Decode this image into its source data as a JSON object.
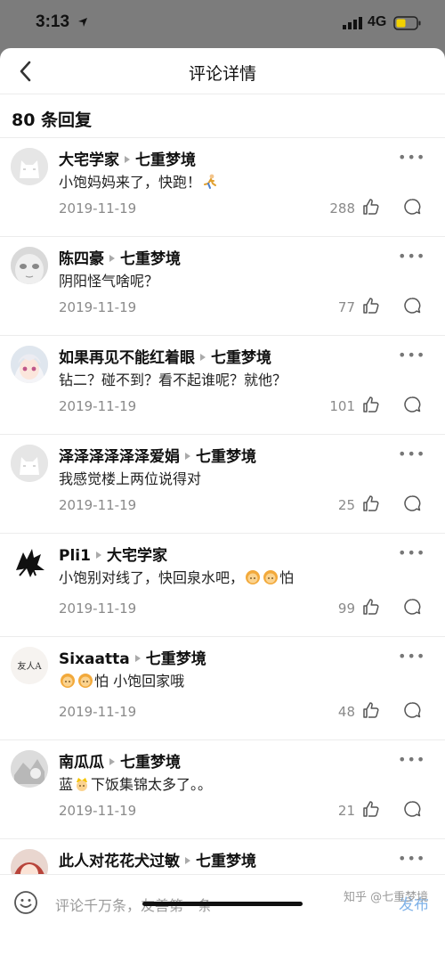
{
  "status_bar": {
    "time": "3:13",
    "network": "4G"
  },
  "header": {
    "title": "评论详情"
  },
  "reply_count": "80 条回复",
  "comments": [
    {
      "user": "大宅学家",
      "reply_to": "七重梦境",
      "text": "小饱妈妈来了，快跑！",
      "emoji_after": "runner",
      "date": "2019-11-19",
      "likes": "288",
      "avatar": "cat-avatar"
    },
    {
      "user": "陈四豪",
      "reply_to": "七重梦境",
      "text": "阴阳怪气啥呢？",
      "date": "2019-11-19",
      "likes": "77",
      "avatar": "face-avatar"
    },
    {
      "user": "如果再见不能红着眼",
      "reply_to": "七重梦境",
      "text": "钻二？碰不到？看不起谁呢？就他？",
      "date": "2019-11-19",
      "likes": "101",
      "avatar": "anime-girl-avatar"
    },
    {
      "user": "泽泽泽泽泽泽爱娟",
      "reply_to": "七重梦境",
      "text": "我感觉楼上两位说得对",
      "date": "2019-11-19",
      "likes": "25",
      "avatar": "cat-avatar"
    },
    {
      "user": "Pli1",
      "reply_to": "大宅学家",
      "text_before": "小饱别对线了，快回泉水吧，",
      "text_after": "怕",
      "date": "2019-11-19",
      "likes": "99",
      "avatar": "ink-avatar"
    },
    {
      "user": "Sixaatta",
      "reply_to": "七重梦境",
      "text_after": "怕 小饱回家哦",
      "date": "2019-11-19",
      "likes": "48",
      "avatar": "calligraphy-avatar",
      "avatar_text": "友人A"
    },
    {
      "user": "南瓜瓜",
      "reply_to": "七重梦境",
      "text_before": "蓝",
      "text_after": "下饭集锦太多了。。",
      "date": "2019-11-19",
      "likes": "21",
      "avatar": "sketch-avatar"
    },
    {
      "user": "此人对花花犬过敏",
      "reply_to": "七重梦境",
      "avatar": "red-hair-avatar"
    }
  ],
  "input_bar": {
    "placeholder": "评论千万条，友善第一条",
    "publish_label": "发布"
  },
  "watermark": "知乎 @七重梦境",
  "colors": {
    "publish": "#7fb2e8",
    "meta_gray": "#8a8a8a"
  }
}
